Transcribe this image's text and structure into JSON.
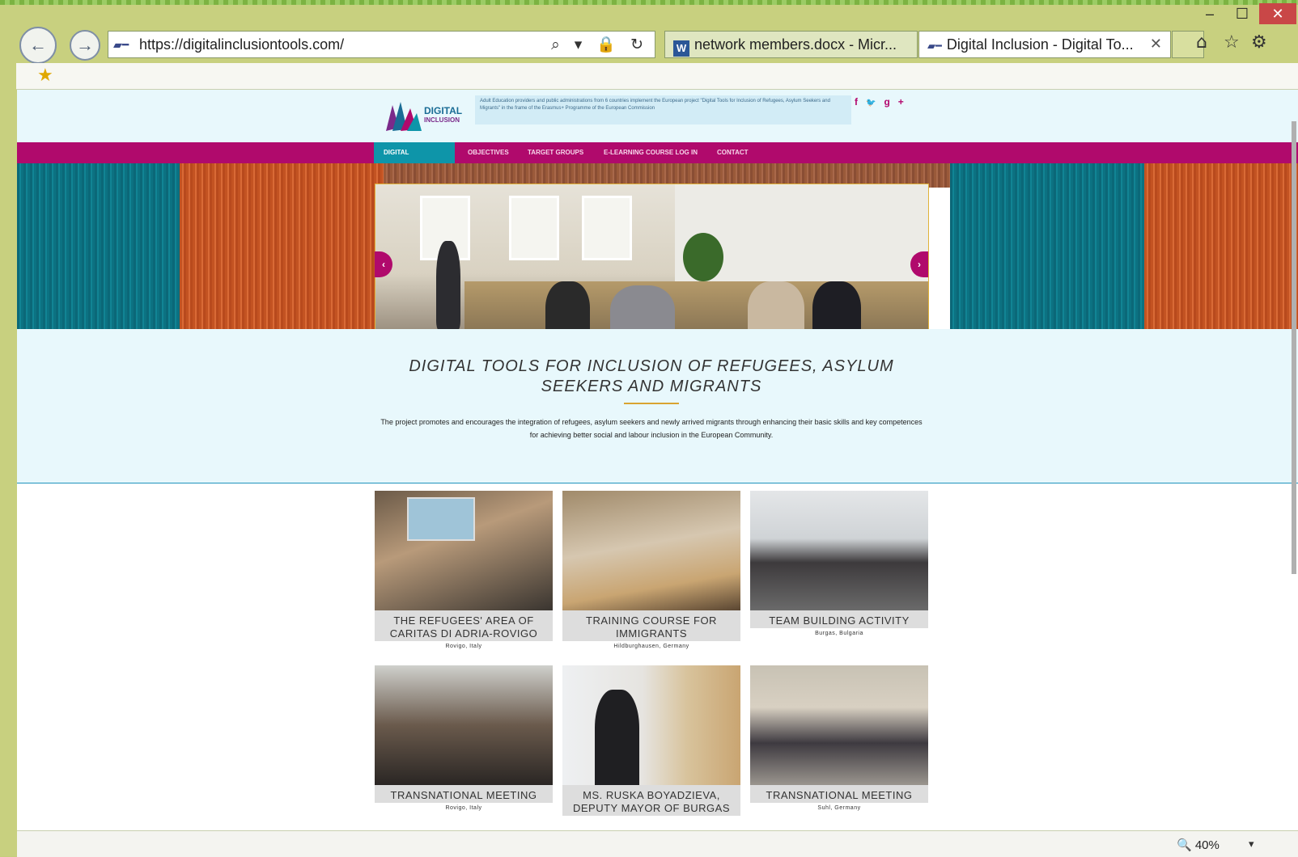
{
  "browser": {
    "window_controls": {
      "minimize": "–",
      "maximize": "☐",
      "close": "✕"
    },
    "address": {
      "url": "https://digitalinclusiontools.com/",
      "tools": "⌕ ▾ 🔒 ↻"
    },
    "tabs": [
      {
        "label": "network members.docx - Micr...",
        "icon": "word-icon"
      },
      {
        "label": "Digital Inclusion - Digital To...",
        "icon": "site-favicon",
        "close": "✕"
      }
    ],
    "toolbar_icons": {
      "home": "⌂",
      "favorites": "☆",
      "settings": "⚙"
    },
    "status": {
      "zoom": "🔍 40%",
      "zoom_dropdown": "▾"
    }
  },
  "site": {
    "logo": {
      "main": "DIGITAL",
      "sub": "INCLUSION"
    },
    "tagline": "Adult Education providers and public administrations from 6 countries implement the European project \"Digital Tools for Inclusion of Refugees, Asylum Seekers and Migrants\" in the frame of the Erasmus+ Programme of the European Commission",
    "social": {
      "facebook": "f",
      "twitter": "🐦",
      "googleplus": "g+"
    },
    "menu": [
      "DIGITAL INCLUSION",
      "OBJECTIVES",
      "TARGET GROUPS",
      "E-LEARNING COURSE LOG IN",
      "CONTACT"
    ],
    "slider": {
      "prev": "‹",
      "next": "›",
      "dots": "● ○ ○ ○"
    },
    "title": "DIGITAL TOOLS FOR INCLUSION OF REFUGEES, ASYLUM SEEKERS AND MIGRANTS",
    "description": "The project promotes and encourages the integration of refugees, asylum seekers and newly arrived migrants through enhancing their basic skills and key competences for achieving better social and labour inclusion in the European Community.",
    "cards": [
      {
        "caption": "THE REFUGEES' AREA OF CARITAS DI ADRIA-ROVIGO",
        "location": "Rovigo, Italy"
      },
      {
        "caption": "TRAINING COURSE FOR IMMIGRANTS",
        "location": "Hildburghausen, Germany"
      },
      {
        "caption": "TEAM BUILDING ACTIVITY",
        "location": "Burgas, Bulgaria"
      },
      {
        "caption": "TRANSNATIONAL MEETING",
        "location": "Rovigo, Italy"
      },
      {
        "caption": "MS. RUSKA BOYADZIEVA, DEPUTY MAYOR OF BURGAS",
        "location": ""
      },
      {
        "caption": "TRANSNATIONAL MEETING",
        "location": "Suhl, Germany"
      }
    ]
  },
  "colors": {
    "brand_magenta": "#b00a6c",
    "menu_active": "#0e95a9",
    "header_bg": "#e8f8fc",
    "browser_frame": "#c8d07f"
  }
}
